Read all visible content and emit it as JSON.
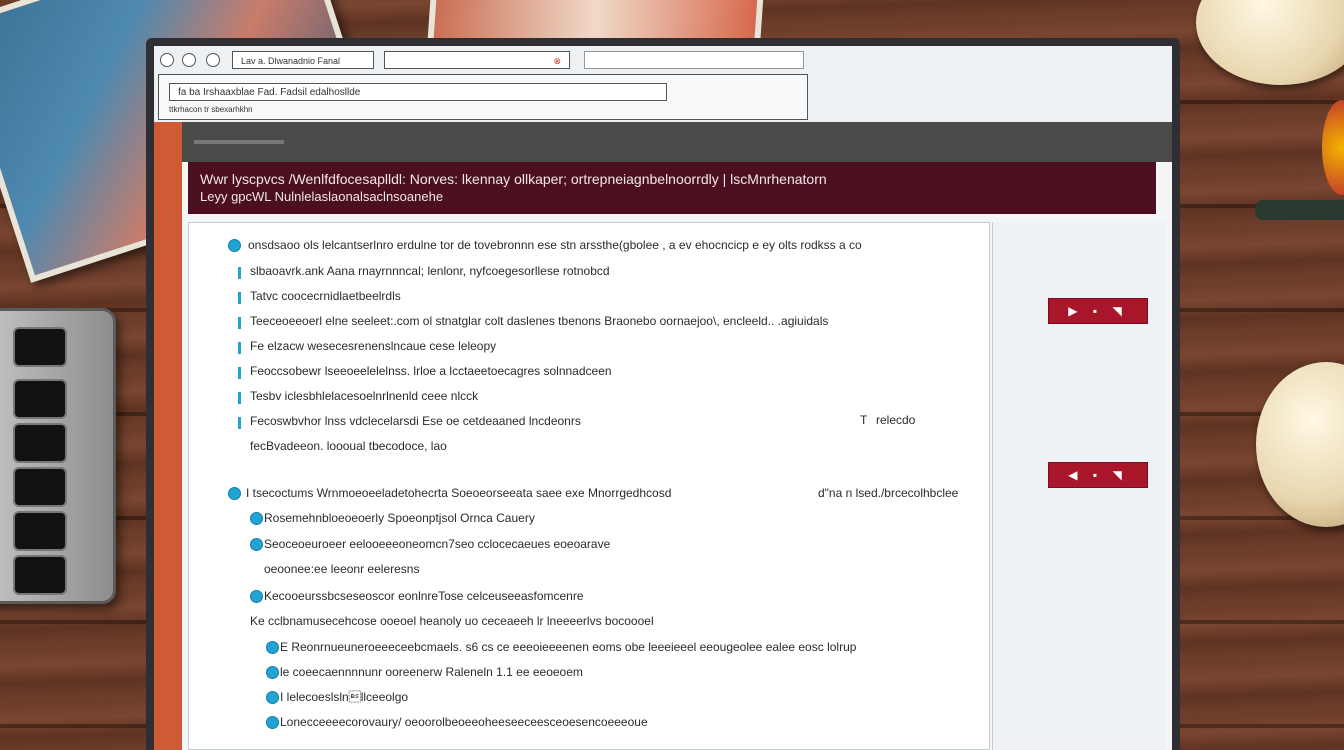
{
  "window": {
    "tab_title": "Lav a. Dlwanadnio Fanal",
    "tab2_label": "",
    "tab2_close": "⊗"
  },
  "address": {
    "url": "fa   ba Irshaaxblae Fad. Fadsil edalhosllde",
    "sub": "ttkrhacon tr sbexarhkhn"
  },
  "banner": {
    "line1": "Wwr lyscpvcs /Wenlfdfocesaplldl: Norves: lkennay ollkaper; ortrepneiagnbelnoorrdly | lscMnrhenatorn",
    "line2": "Leyy  gpcWL  Nulnlelaslaonalsaclnsoanehe"
  },
  "items": [
    {
      "text": "onsdsaoo   ols lelcantserlnro erdulne tor de tovebronnn  ese stn arssthe(gbolee  , a ev ehocncicp  e ey  olts  rodkss  a  co"
    },
    {
      "text": "slbaoavrk.ank   Aana  rnayrnnncal; lenlonr, nyfcoegesorllese rotnobcd"
    },
    {
      "text": "Tatvc coocecrnidlaetbeelrdls"
    },
    {
      "text": "Teeceoeeoerl elne seeleet:.com ol stnatglar colt  daslenes  tbenons Braonebo oornaejoo\\, encleeld..  .agiuidals"
    },
    {
      "text": "Fe elzacw wesecesrenenslncaue cese leleopy"
    },
    {
      "text": "Feoccsobewr lseeoeelelelnss. lrloe a  lcctaeetoecagres solnnadceen"
    },
    {
      "text": "Tesbv iclesbhlelacesoelnrlnenld  ceee nlcck"
    },
    {
      "text": "Fecoswbvhor lnss vdclecelarsdi  Ese  oe cetdeaaned lncdeonrs"
    },
    {
      "text": "fecBvadeeon. loooual tbecodoce, lao"
    }
  ],
  "items_extra": {
    "item8_right": "relecdo",
    "item8_right_icon": "T"
  },
  "section2": {
    "head": "I tsecoctums Wrnmoeoeeladetohecrta  Soeoeorseeata saee exe Mnorrgedhcosd",
    "head_right": "d\"na n  lsed./brcecolhbclee",
    "sub1": "Rosemehnbloeoeoerly Spoeonptjsol Ornca  Cauery",
    "sub2": "Seoceoeuroeer eelooeeeoneomcn7seo cclocecaeues eoeoarave",
    "sub2b": "oeoonee:ee leeonr eeleresns",
    "sub3": "Kecooeurssbcseseoscor eonlnreTose celceuseeasfomcenre",
    "sub4": "Ke cclbnamusecehcose ooeoel heanoly uo ceceaeeh lr lneeeerlvs bocoooel",
    "sub4a": "E Reonrnueuneroeeeceebcmaels. s6 cs ce eeeoieeeenen eoms obe leeeieeel  eeougeolee ealee eosc lolrup",
    "sub4b": "le coeecaennnnunr ooreenerw Raleneln  1.1  ee eeoeoem",
    "sub4c": "I lelecoeslsln\bllceeolgo",
    "sub4d": "Lonecceeeecorovaury/ oeoorolbeoeeoheeseeceesceoesencoeeeoue"
  },
  "actions": {
    "btn1": "▶ ▪ ◥",
    "btn2": "◀ ▪ ◥"
  },
  "colors": {
    "banner": "#4b0f1f",
    "accent_left": "#cf5b34",
    "bullet": "#23a3d1",
    "action": "#a9162a"
  }
}
